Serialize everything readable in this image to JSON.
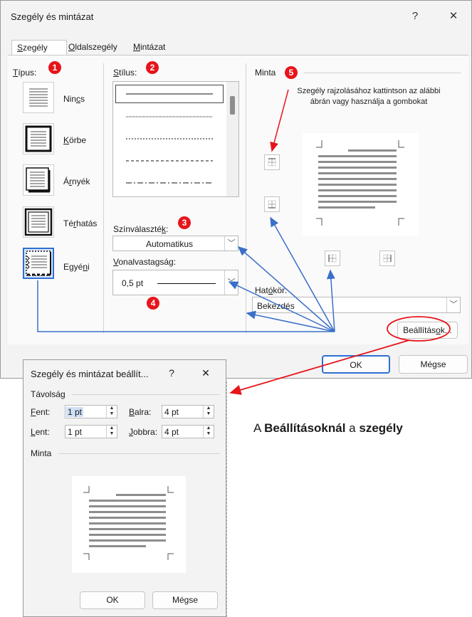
{
  "main": {
    "title": "Szegély és mintázat",
    "help": "?",
    "close": "✕",
    "tabs": [
      {
        "pre": "",
        "u": "S",
        "post": "zegély"
      },
      {
        "pre": "",
        "u": "O",
        "post": "ldalszegély"
      },
      {
        "pre": "",
        "u": "M",
        "post": "intázat"
      }
    ],
    "type_label": {
      "pre": "",
      "u": "T",
      "post": "ípus:"
    },
    "types": [
      {
        "pre": "Nin",
        "u": "c",
        "post": "s"
      },
      {
        "pre": "",
        "u": "K",
        "post": "örbe"
      },
      {
        "pre": "Á",
        "u": "r",
        "post": "nyék"
      },
      {
        "pre": "Té",
        "u": "r",
        "post": "hatás"
      },
      {
        "pre": "Egyé",
        "u": "n",
        "post": "i"
      }
    ],
    "style_label": {
      "pre": "",
      "u": "S",
      "post": "tílus:"
    },
    "color_label": {
      "pre": "Színválaszté",
      "u": "k",
      "post": ":"
    },
    "color_value": "Automatikus",
    "width_label": {
      "pre": "",
      "u": "V",
      "post": "onalvastagság:"
    },
    "width_value": "0,5 pt",
    "preview_label": "Minta",
    "preview_hint": "Szegély rajzolásához kattintson az alábbi ábrán vagy használja a gombokat",
    "scope_label": {
      "pre": "Hat",
      "u": "ó",
      "post": "kör:"
    },
    "scope_value": "Bekezdés",
    "options_button": {
      "pre": "Beállítás",
      "u": "o",
      "post": "k..."
    },
    "ok": "OK",
    "cancel": "Mégse"
  },
  "badges": [
    "1",
    "2",
    "3",
    "4",
    "5"
  ],
  "sub": {
    "title": "Szegély és mintázat beállít...",
    "help": "?",
    "close": "✕",
    "distance_label": "Távolság",
    "fields": [
      {
        "pre": "",
        "u": "F",
        "post": "ent:",
        "value": "1 pt"
      },
      {
        "pre": "",
        "u": "B",
        "post": "alra:",
        "value": "4 pt"
      },
      {
        "pre": "",
        "u": "L",
        "post": "ent:",
        "value": "1 pt"
      },
      {
        "pre": "",
        "u": "J",
        "post": "obbra:",
        "value": "4 pt"
      }
    ],
    "preview_label": "Minta",
    "ok": "OK",
    "cancel": "Mégse"
  },
  "caption": {
    "a": "A ",
    "b": "Beállításoknál",
    "c": " a ",
    "d": "szegély"
  },
  "colors": {
    "badge": "#e8141b",
    "arrow_blue": "#3a6fc9",
    "arrow_red": "#e8141b"
  }
}
